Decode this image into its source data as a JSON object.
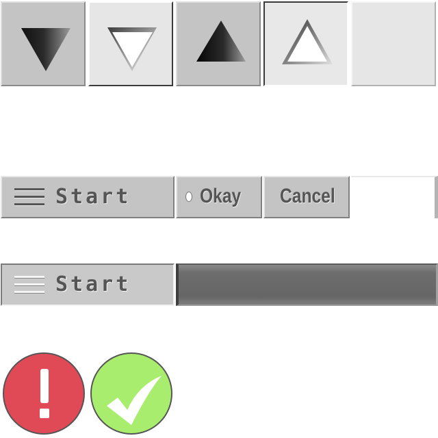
{
  "arrow_tiles": [
    {
      "name": "scroll-down-raised-dark",
      "icon": "triangle-down-icon"
    },
    {
      "name": "scroll-down-raised-light",
      "icon": "triangle-down-icon"
    },
    {
      "name": "scroll-up-sunken-dark",
      "icon": "triangle-up-icon"
    },
    {
      "name": "scroll-up-sunken-light",
      "icon": "triangle-up-icon"
    },
    {
      "name": "blank-tile"
    }
  ],
  "taskbar_row": {
    "start_label": "Start",
    "menu_icon": "hamburger-menu-icon",
    "okay_label": "Okay",
    "radio_icon": "radio-dot-icon",
    "cancel_label": "Cancel"
  },
  "taskbar_pressed": {
    "start_label": "Start",
    "menu_icon": "hamburger-menu-icon"
  },
  "status_icons": [
    {
      "name": "error-icon",
      "glyph": "!",
      "color": "#e04a57"
    },
    {
      "name": "success-check-icon",
      "color": "#a9ed6f"
    }
  ]
}
